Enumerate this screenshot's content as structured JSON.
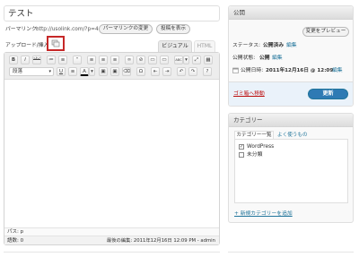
{
  "post": {
    "title": "テスト",
    "permalink_label": "パーマリンク:",
    "permalink_url": "http://usolink.com/?p=4",
    "change_permalink_button": "パーマリンクの変更",
    "view_post_button": "投稿を表示"
  },
  "editor": {
    "upload_label": "アップロード/挿入",
    "tab_visual": "ビジュアル",
    "tab_html": "HTML",
    "format_select": "段落",
    "toolbar_row1": [
      "B",
      "I",
      "abc",
      "≔",
      "≡",
      "“",
      "≡",
      "≡",
      "≡",
      "∞",
      "⊘",
      "▭",
      "▭",
      "ABC",
      "▾",
      "⤢",
      "▦"
    ],
    "toolbar_row2": [
      "U",
      "≡",
      "A",
      "▾",
      "▣",
      "▣",
      "⌫",
      "Ω",
      "⇤",
      "⇥",
      "↶",
      "↷",
      "?"
    ],
    "path_label": "パス: p",
    "word_count": "語数: 0",
    "last_edited": "最後の編集: 2011年12月16日 12:09 PM - admin"
  },
  "publish": {
    "title": "公開",
    "preview_button": "変更をプレビュー",
    "status_label": "ステータス:",
    "status_value": "公開済み",
    "status_edit": "編集",
    "visibility_label": "公開状態:",
    "visibility_value": "公開",
    "visibility_edit": "編集",
    "date_label": "公開日時:",
    "date_value": "2011年12月16日 @ 12:09",
    "date_edit": "編集",
    "trash_link": "ゴミ箱へ移動",
    "update_button": "更新"
  },
  "categories": {
    "title": "カテゴリー",
    "tab_all": "カテゴリー一覧",
    "tab_popular": "よく使うもの",
    "items": [
      {
        "label": "WordPress",
        "checked": true
      },
      {
        "label": "未分類",
        "checked": false
      }
    ],
    "add_new": "+ 新規カテゴリーを追加"
  },
  "colors": {
    "accent_blue": "#21759b",
    "update_button": "#2e7ab4",
    "trash_red": "#bc0b0b",
    "highlight_box": "#c62828"
  }
}
